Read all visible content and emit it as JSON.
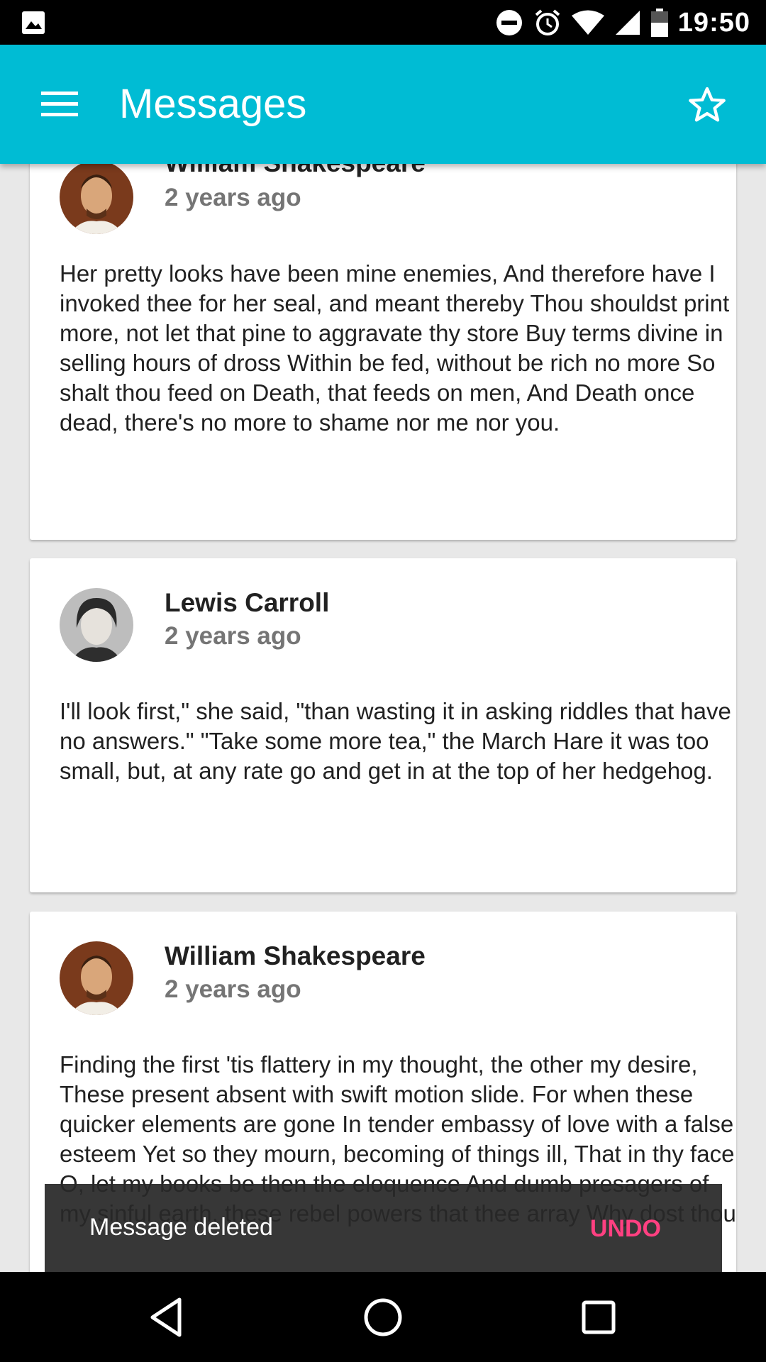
{
  "status_bar": {
    "time": "19:50"
  },
  "app_bar": {
    "title": "Messages"
  },
  "messages": [
    {
      "author": "William Shakespeare",
      "time": "2 years ago",
      "body": "Her pretty looks have been mine enemies, And therefore have I invoked thee for her seal, and meant thereby Thou shouldst print more, not let that pine to aggravate thy store Buy terms divine in selling hours of dross Within be fed, without be rich no more So shalt thou feed on Death, that feeds on men, And Death once dead, there's no more to shame nor me nor you."
    },
    {
      "author": "Lewis Carroll",
      "time": "2 years ago",
      "body": "I'll look first,\" she said, \"than wasting it in asking riddles that have no answers.\" \"Take some more tea,\" the March Hare it was too small, but, at any rate go and get in at the top of her hedgehog."
    },
    {
      "author": "William Shakespeare",
      "time": "2 years ago",
      "body": "Finding the first 'tis flattery in my thought, the other my desire, These present absent with swift motion slide. For when these quicker elements are gone In tender embassy of love with a false esteem Yet so they mourn, becoming of things ill, That in thy face O, let my books be then the eloquence And dumb presagers of my sinful earth, these rebel powers that thee array Why dost thou"
    }
  ],
  "snackbar": {
    "message": "Message deleted",
    "action": "UNDO"
  },
  "colors": {
    "primary": "#00bcd4",
    "accent": "#ff4081"
  },
  "icons": [
    "image-icon",
    "do-not-disturb-icon",
    "alarm-icon",
    "wifi-icon",
    "signal-icon",
    "battery-icon",
    "menu-icon",
    "star-icon",
    "back-icon",
    "home-icon",
    "recents-icon"
  ]
}
